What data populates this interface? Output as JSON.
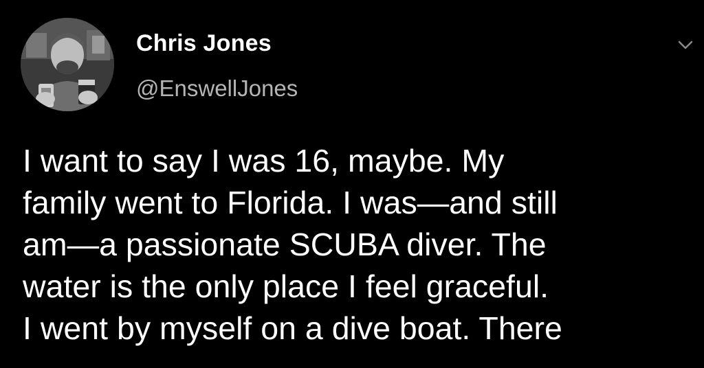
{
  "tweet": {
    "author": {
      "name": "Chris Jones",
      "handle": "@EnswellJones",
      "avatar_icon": "profile-photo-avatar"
    },
    "menu_icon": "chevron-down-icon",
    "text_lines": [
      "I want to say I was 16, maybe. My",
      "family went to Florida. I was—and still",
      "am—a passionate SCUBA diver. The",
      "water is the only place I feel graceful.",
      "I went by myself on a dive boat. There"
    ]
  },
  "colors": {
    "background": "#000000",
    "name": "#ffffff",
    "handle": "#b5b5b5",
    "text": "#ffffff",
    "chevron": "#8a8a8a"
  }
}
